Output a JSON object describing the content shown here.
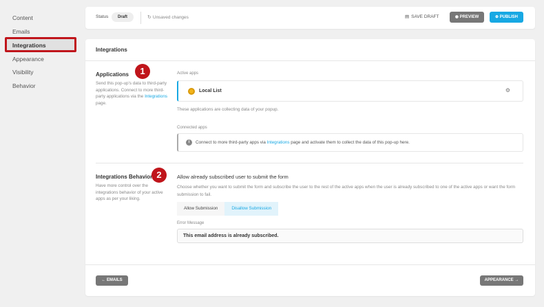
{
  "sidebar": {
    "items": [
      {
        "label": "Content"
      },
      {
        "label": "Emails"
      },
      {
        "label": "Integrations"
      },
      {
        "label": "Appearance"
      },
      {
        "label": "Visibility"
      },
      {
        "label": "Behavior"
      }
    ],
    "active": "Integrations"
  },
  "topbar": {
    "status_label": "Status",
    "status_value": "Draft",
    "unsaved": "Unsaved changes",
    "save_draft": "SAVE DRAFT",
    "preview": "PREVIEW",
    "publish": "PUBLISH"
  },
  "panel": {
    "title": "Integrations",
    "applications": {
      "title": "Applications",
      "desc_pre": "Send this pop-up's data to third-party applications. Connect to more third-party applications via the ",
      "desc_link": "Integrations",
      "desc_post": " page.",
      "badge": "1",
      "active_label": "Active apps",
      "active_app": "Local List",
      "active_help": "These applications are collecting data of your popup.",
      "connected_label": "Connected apps",
      "notice_pre": "Connect to more third-party apps via ",
      "notice_link": "Integrations",
      "notice_post": " page and activate them to collect the data of this pop-up here."
    },
    "behavior": {
      "title": "Integrations Behavior",
      "desc": "Have more control over the integrations behavior of your active apps as per your liking.",
      "badge": "2",
      "field_title": "Allow already subscribed user to submit the form",
      "field_desc": "Choose whether you want to submit the form and subscribe the user to the rest of the active apps when the user is already subscribed to one of the active apps or want the form submission to fail.",
      "options": [
        "Allow Submission",
        "Disallow Submission"
      ],
      "selected": "Disallow Submission",
      "error_label": "Error Message",
      "error_value": "This email address is already subscribed."
    },
    "footer": {
      "back": "EMAILS",
      "next": "APPEARANCE"
    }
  },
  "colors": {
    "accent": "#17a8e3",
    "highlight": "#c0151b",
    "button_gray": "#777777"
  },
  "icons": [
    "refresh-icon",
    "save-icon",
    "eye-icon",
    "globe-icon",
    "gear-icon",
    "info-icon",
    "arrow-left-icon",
    "arrow-right-icon",
    "app-icon"
  ]
}
